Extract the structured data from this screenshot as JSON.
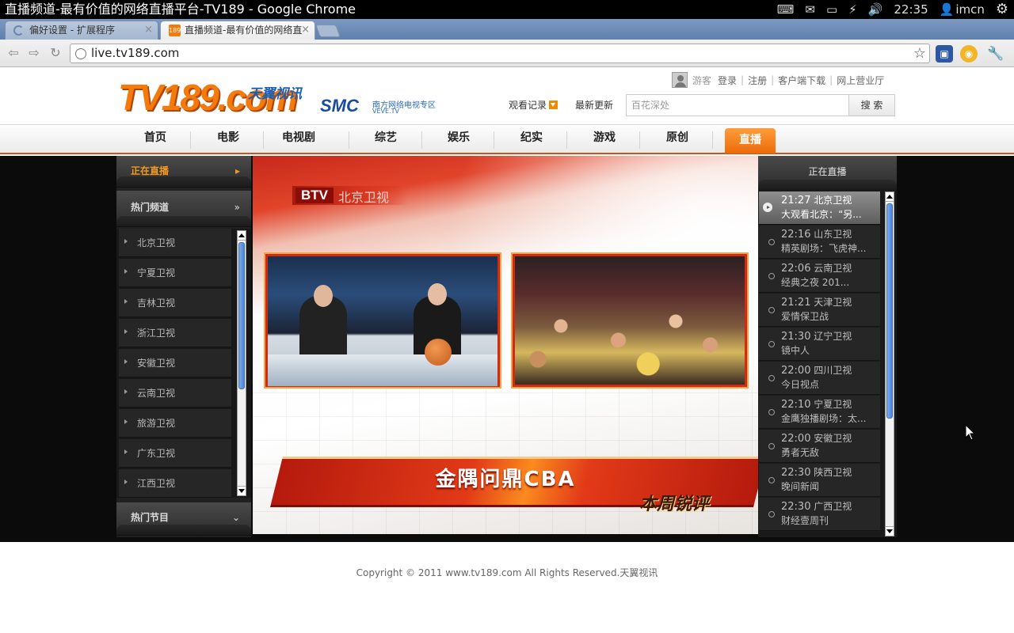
{
  "window": {
    "title": "直播频道-最有价值的网络直播平台-TV189 - Google Chrome"
  },
  "system_tray": {
    "clock": "22:35",
    "user": "imcn"
  },
  "tabs": [
    {
      "label": "偏好设置 - 扩展程序",
      "close": "×"
    },
    {
      "label": "直播频道-最有价值的网络直",
      "close": "×"
    }
  ],
  "toolbar": {
    "url": "live.tv189.com"
  },
  "site": {
    "logo_text": "TV189.com",
    "brand_text": "天翼视讯",
    "smc_text": "SMC",
    "smc_subtitle": "南方网络电视专区",
    "smc_domain": "VEVE.TV",
    "user_links": {
      "guest": "游客",
      "login": "登录",
      "register": "注册",
      "client_download": "客户端下载",
      "online_hall": "网上营业厅"
    },
    "history_label": "观看记录",
    "latest_label": "最新更新",
    "search": {
      "placeholder": "百花深处",
      "button": "搜 索"
    },
    "nav": [
      "首页",
      "电影",
      "电视剧",
      "综艺",
      "娱乐",
      "纪实",
      "游戏",
      "原创",
      "直播"
    ]
  },
  "left_panel": {
    "live_label": "正在直播",
    "hot_channels_label": "热门频道",
    "hot_programs_label": "热门节目",
    "channels": [
      "北京卫视",
      "宁夏卫视",
      "吉林卫视",
      "浙江卫视",
      "安徽卫视",
      "云南卫视",
      "旅游卫视",
      "广东卫视",
      "江西卫视"
    ]
  },
  "video": {
    "station": "BTV",
    "station_name": "北京卫视",
    "banner": "金隅问鼎CBA",
    "tag": "本周锐评"
  },
  "right_panel": {
    "title": "正在直播",
    "programs": [
      {
        "time": "21:27",
        "channel": "北京卫视",
        "title": "大观看北京：“另...",
        "selected": true
      },
      {
        "time": "22:16",
        "channel": "山东卫视",
        "title": "精英剧场：飞虎神..."
      },
      {
        "time": "22:06",
        "channel": "云南卫视",
        "title": "经典之夜 201..."
      },
      {
        "time": "21:21",
        "channel": "天津卫视",
        "title": "爱情保卫战"
      },
      {
        "time": "21:30",
        "channel": "辽宁卫视",
        "title": "镜中人"
      },
      {
        "time": "22:00",
        "channel": "四川卫视",
        "title": "今日视点"
      },
      {
        "time": "22:10",
        "channel": "宁夏卫视",
        "title": "金鹰独播剧场：太..."
      },
      {
        "time": "22:00",
        "channel": "安徽卫视",
        "title": "勇者无敌"
      },
      {
        "time": "22:30",
        "channel": "陕西卫视",
        "title": "晚间新闻"
      },
      {
        "time": "22:30",
        "channel": "广西卫视",
        "title": "财经壹周刊"
      }
    ]
  },
  "footer": {
    "copyright": "Copyright © 2011 www.tv189.com All Rights Reserved.天翼视讯"
  }
}
